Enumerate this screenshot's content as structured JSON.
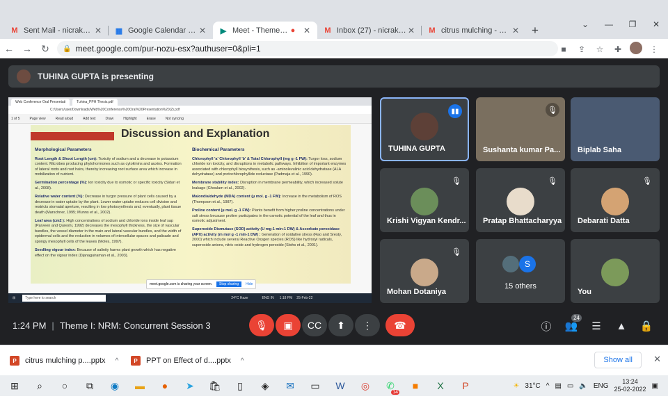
{
  "browser": {
    "tabs": [
      {
        "label": "Sent Mail - nicrakolkata@",
        "icon": "gmail-icon"
      },
      {
        "label": "Google Calendar - Februa",
        "icon": "calendar-icon"
      },
      {
        "label": "Meet - Theme I: NRM",
        "icon": "meet-icon"
      },
      {
        "label": "Inbox (27) - nicrakolkata@",
        "icon": "gmail-icon"
      },
      {
        "label": "citrus mulching - dipanka",
        "icon": "gmail-icon"
      }
    ],
    "url": "meet.google.com/pur-nozu-esx?authuser=0&pli=1"
  },
  "presenter_banner": "TUHINA GUPTA is presenting",
  "shared_screen": {
    "tabs": [
      "Web Conference Oral Presentati",
      "Tuhina_PPH Thesis.pdf"
    ],
    "address": "C:/Users/user/Downloads/Web%20Conference%20Oral%20Presentation%20(2).pdf",
    "pdf_tools": [
      "1 of 5",
      "Page view",
      "Read aloud",
      "Add text",
      "Draw",
      "Highlight",
      "Erase",
      "Not syncing"
    ],
    "slide": {
      "title": "Discussion and Explanation",
      "left_heading": "Morphological Parameters",
      "left_items": [
        {
          "label": "Root Length & Shoot Length (cm):",
          "text": "Toxicity of sodium and a decrease in potassium content. Microbes producing phytohormones such as cytokinins and auxins. Formation of lateral roots and root hairs, thereby increasing root surface area which increase in mobilization of nutrient."
        },
        {
          "label": "Germination percentage (%):",
          "text": "Ion toxicity due to osmotic or specific toxicity (Sidari et al., 2008)."
        },
        {
          "label": "Relative water content (%):",
          "text": "Decrease in turgor pressure of plant cells caused by a decrease in water uptake by the plant. Lower water uptake reduces cell division and restricts stomatal aperture, resulting in low photosynthesis and, eventually, plant tissue death (Marschner, 1995; Munns et al., 2002)."
        },
        {
          "label": "Leaf area (cm2 ):",
          "text": "High concentrations of sodium and chloride ions inside leaf sap (Parveen and Qureshi, 1992) decreases the mesophyll thickness, the size of vascular bundles, the vessel diameter in the main and lateral vascular bundles, and the width of epidermal cells and the reduction in volumes of intercellular spaces and palisade and spongy mesophyll cells of the leaves (Moles, 1997)."
        },
        {
          "label": "Seedling vigour index:",
          "text": "Because of salinity harms plant growth which has negative effect on the vigour index (Djanaguiraman et al., 2003)."
        }
      ],
      "right_heading": "Biochemical Parameters",
      "right_items": [
        {
          "label": "Chlorophyll 'a' Chlorophyll 'b' & Total Chlorophyll (mg g -1 FW):",
          "text": "Turgor loss, sodium chloride ion toxicity, and disruptions in metabolic pathways. Inhibition of important enzymes associated with chlorophyll biosynthesis, such as -aminolevulinic acid dehydratase (ALA dehydratase) and protochlorophyllide reductase (Padmaja et al., 1990)."
        },
        {
          "label": "Membrane stability index:",
          "text": "Disruption in membrane permeability, which increased solute leakage (Ghoulam et al., 2002)."
        },
        {
          "label": "Malondialdehyde (MDA) content (µ mol. g -1 FW):",
          "text": "Increase in the metabolism of ROS (Thompson et al., 1987)."
        },
        {
          "label": "Proline content (µ mol. g -1 FW):",
          "text": "Plants benefit from higher proline concentrations under salt stress because proline participates in the osmotic potential of the leaf and thus in osmotic adjustment."
        },
        {
          "label": "Superoxide Dismutase (SOD) activity (U mg-1 min-1 DW) & Ascorbate peroxidase (APX) activity (m mol g -1 min-1 DW) :",
          "text": "Generation of oxidative stress (Rao and Sresty, 2000) which include several Reactive Oxygen species (ROS) like hydroxyl radicals, superoxide anions, nitric oxide and hydrogen peroxide (Stohs et al., 2001)."
        }
      ]
    },
    "share_notice": "meet.google.com is sharing your screen.",
    "share_stop": "Stop sharing",
    "share_hide": "Hide",
    "taskbar_search": "Type here to search",
    "taskbar_weather": "24°C Haze",
    "taskbar_lang": "ENG IN",
    "taskbar_time": "1:18 PM",
    "taskbar_date": "25-Feb-22"
  },
  "participants": [
    {
      "name": "TUHINA GUPTA",
      "muted": false,
      "speaking": true
    },
    {
      "name": "Sushanta kumar Pa...",
      "muted": true
    },
    {
      "name": "Biplab Saha",
      "muted": false
    },
    {
      "name": "Krishi Vigyan Kendr...",
      "muted": true
    },
    {
      "name": "Pratap Bhattacharyya",
      "muted": true
    },
    {
      "name": "Debarati Datta",
      "muted": true
    },
    {
      "name": "Mohan Dotaniya",
      "muted": true
    },
    {
      "name": "15 others",
      "initial": "S"
    },
    {
      "name": "You",
      "muted": false
    }
  ],
  "meeting": {
    "time": "1:24 PM",
    "title": "Theme I: NRM: Concurrent Session 3",
    "people_count": "24"
  },
  "downloads": [
    {
      "name": "citrus mulching p....pptx"
    },
    {
      "name": "PPT on Effect of d....pptx"
    }
  ],
  "downloads_show_all": "Show all",
  "taskbar": {
    "temperature": "31°C",
    "language": "ENG",
    "time": "13:24",
    "date": "25-02-2022",
    "whatsapp_badge": "14"
  },
  "colors": {
    "meet_bg": "#202124",
    "tile_bg": "#3c4043",
    "red": "#ea4335",
    "blue": "#1a73e8"
  }
}
